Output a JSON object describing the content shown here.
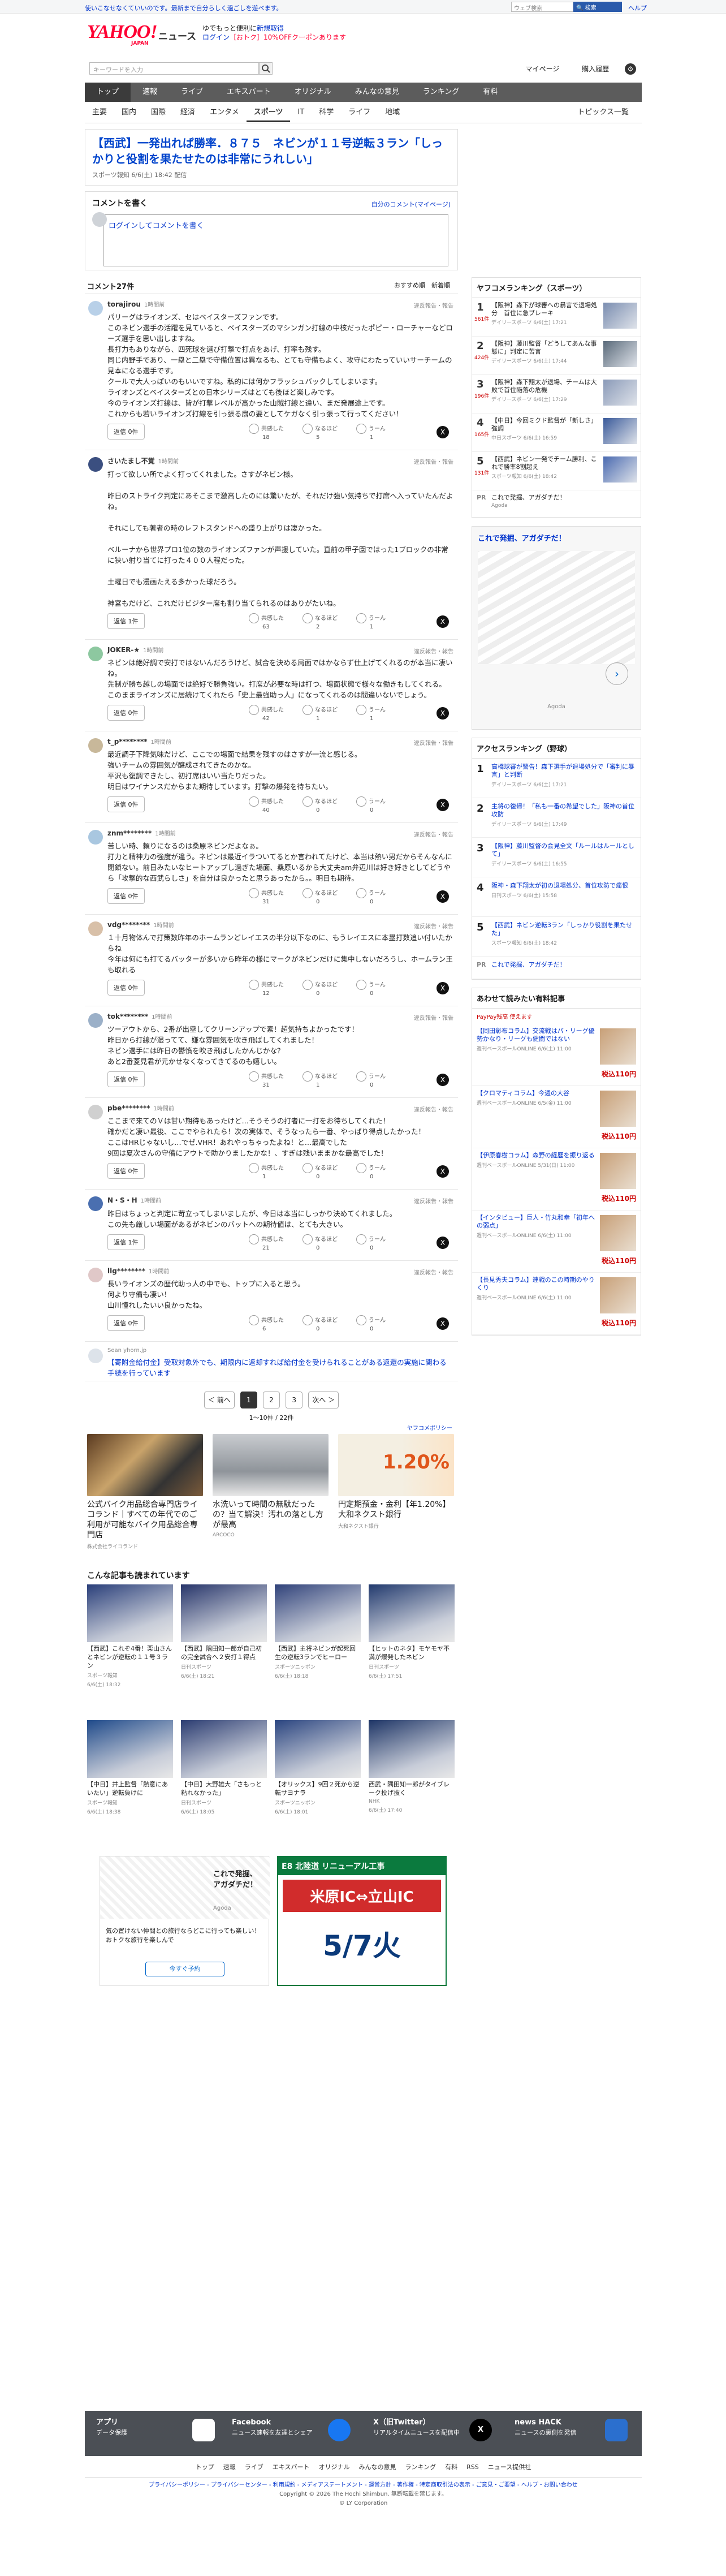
{
  "top": {
    "promo": "使いこなせなくていいのです。最新まで自分らしく過ごしを遊べます。",
    "links": "Yahoo! JAPAN　ヘルプ",
    "search_placeholder": "ウェブ検索",
    "search_button": "🔍 検索"
  },
  "header": {
    "logo_main": "YAHOO!",
    "logo_sub": "JAPAN",
    "service": "ニュース",
    "promo_line1": "ゆでもっと便利に",
    "promo_line1_link": "新規取得",
    "promo_line2_link": "ログイン",
    "promo_line2": "［おトク］10%OFFクーポンあります",
    "keyword_placeholder": "キーワードを入力",
    "mypage": "マイページ",
    "purchase": "購入履歴"
  },
  "nav1": [
    "トップ",
    "速報",
    "ライブ",
    "エキスパート",
    "オリジナル",
    "みんなの意見",
    "ランキング",
    "有料"
  ],
  "nav2": [
    "主要",
    "国内",
    "国際",
    "経済",
    "エンタメ",
    "スポーツ",
    "IT",
    "科学",
    "ライフ",
    "地域"
  ],
  "nav2_active": "スポーツ",
  "nav2_topics": "トピックス一覧",
  "article": {
    "title": "【西武】一発出れば勝率．８７５　ネビンが１１号逆転３ラン「しっかりと役割を果たせたのは非常にうれしい」",
    "meta": "スポーツ報知 6/6(土) 18:42 配信"
  },
  "comment_write": {
    "heading": "コメントを書く",
    "policy": "自分のコメント(マイページ)",
    "box": "ログインしてコメントを書く"
  },
  "comment_list": {
    "count": "コメント27件",
    "sort": "おすすめ順　新着順",
    "reply_label": "返信",
    "report_label": "違反報告・報告",
    "react_labels": [
      "共感した",
      "なるほど",
      "うーん"
    ],
    "items": [
      {
        "user": "torajirou",
        "time": "1時間前",
        "text": "パリーグはライオンズ、セはベイスターズファンです。\nこのネビン選手の活躍を見ていると、ベイスターズのマシンガン打線の中核だったポピー・ローチャーなどローズ選手を思い出しますね。\n長打力もありながら、四死球を選び打撃で打点をあげ、打率も残す。\n同じ内野手であり、一塁と二塁で守備位置は異なるも、とても守備もよく、攻守にわたっていいサーチームの見本になる選手です。\nクールで大人っぽいのもいいですね。私的には何かフラッシュバックしてしまいます。\nライオンズとベイスターズとの日本シリーズはとても後ほど楽しみです。\n今のライオンズ打線は、皆が打撃レベルが高かった山賊打線と違い、まだ発展途上です。\nこれからも若いライオンズ打線を引っ張る扇の要としてケガなく引っ張って行ってください！",
        "reply": "返信 0件",
        "r": [
          18,
          5,
          1
        ]
      },
      {
        "user": "さいたまし不覚",
        "time": "1時間前",
        "text": "打って欲しい所でよく打ってくれました。さすがネビン様。\n\n昨日のストライク判定にあそこまで激高したのには驚いたが、それだけ強い気持ちで打席へ入っていたんだよね。\n\nそれにしても著者の時のレフトスタンドへの盛り上がりは凄かった。\n\nベルーナから世界プロ1位の数のライオンズファンが声援していた。直前の甲子園ではった1ブロックの非常に狭い射り当てに打った４００人程だった。\n\n土曜日でも漫画たえる多かった球だろう。\n\n神宮もだけど、これだけビジター席も割り当てられるのはありがたいね。",
        "reply": "返信 1件",
        "r": [
          63,
          2,
          1
        ]
      },
      {
        "user": "JOKER-★",
        "time": "1時間前",
        "text": "ネビンは絶好調で安打ではないんだろうけど、試合を決める局面ではかならず仕上げてくれるのが本当に凄いね。\n先制が勝ち越しの場面では絶好で勝負強い。打席が必要な時は打つ、場面状態で様々な働きもしてくれる。\nこのままライオンズに居続けてくれたら「史上最強助っ人」になってくれるのは間違いないでしょう。",
        "reply": "返信 0件",
        "r": [
          42,
          1,
          1
        ]
      },
      {
        "user": "t_p********",
        "time": "1時間前",
        "text": "最近調子下降気味だけど、ここでの場面で結果を残すのはさすが一流と感じる。\n強いチームの雰囲気が醸成されてきたのかな。\n平沢も復調できたし、初打席はいい当たりだった。\n明日はワイナンスだからまた期待しています。打撃の爆発を待ちたい。",
        "reply": "返信 0件",
        "r": [
          40,
          0,
          0
        ]
      },
      {
        "user": "znm********",
        "time": "1時間前",
        "text": "苦しい時、頼りになるのは桑原ネビンだよなぁ。\n打力と精神力の強度が違う。ネビンは最近イラついてるとか言われてたけど、本当は熱い男だからそんなんに閉鎖ない。前日みたいなヒートアップし過ぎた場面、桑原いるから大丈夫am弁辺川は好き好きとしてどうやら「攻撃的な西武らしさ」を自分は良かったと思うあったから。。明日も期待。",
        "reply": "返信 0件",
        "r": [
          31,
          0,
          0
        ]
      },
      {
        "user": "vdg********",
        "time": "1時間前",
        "text": "１十月物体んで打策数昨年のホームランどレイエスの半分以下なのに、もうレイエスに本塁打数追い付いたからね\n今年は何にも打てるバッターが多いから昨年の様にマークがネビンだけに集中しないだろうし、ホームラン王も取れる",
        "reply": "返信 0件",
        "r": [
          12,
          0,
          0
        ]
      },
      {
        "user": "tok********",
        "time": "1時間前",
        "text": "ツーアウトから、2番が出塁してクリーンアップで素！超気持ちよかったです！\n昨日から打線が湿ってて、嫌な雰囲気を吹き飛ばしてくれました！\nネビン選手には昨日の鬱憤を吹き飛ばしたかんじかな？\nあと2番菱見君が元かせなくなってきてるのも嬉しい。",
        "reply": "返信 0件",
        "r": [
          31,
          1,
          0
        ]
      },
      {
        "user": "pbe********",
        "time": "1時間前",
        "text": "ここまで来てのＶは甘い期待もあったけど…そうそうの打者に一打をお待ちしてくれた！\n確かだと凄い最後、ここでやられたら！次の実体で、そうなったら一番、やっぱり得点したかった！\nここはHRじゃないし…でゼ.VHR！あれやっちゃったよね！と…最高でした\n9回は夏次さんの守備にアウトで助かりましたかな！、すぎは残いままかな最高でした！",
        "reply": "返信 0件",
        "r": [
          1,
          0,
          0
        ]
      },
      {
        "user": "N・S・H",
        "time": "1時間前",
        "text": "昨日はちょっと判定に苛立ってしまいましたが、今日は本当にしっかり決めてくれました。\nこの先も厳しい場面があるがネビンのバットへの期待値は、とても大きい。",
        "reply": "返信 1件",
        "r": [
          21,
          0,
          0
        ]
      },
      {
        "user": "llg********",
        "time": "1時間前",
        "text": "長いライオンズの歴代助っ人の中でも、トップに入ると思う。\n何より守備も凄い！\n山川憧れしたいい良かったね。",
        "reply": "返信 0件",
        "r": [
          6,
          0,
          0
        ]
      }
    ]
  },
  "promo_comment": {
    "source": "Sean yhorn.jp",
    "text": "【寄附金給付金】受取対象外でも、期限内に返却すれば給付金を受けられることがある返還の実施に関わる手続を行っています"
  },
  "pager": {
    "prev": "＜ 前へ",
    "pages": [
      "1",
      "2",
      "3"
    ],
    "next": "次へ ＞",
    "count": "1〜10件 / 22件"
  },
  "ads": {
    "label": "ヤフコメポリシー",
    "items": [
      {
        "title": "公式バイク用品総合専門店ライコランド｜すべての年代でのご利用が可能なバイク用品総合専門店",
        "sponsor": "株式会社ライコランド"
      },
      {
        "title": "水洗いって時間の無駄だったの？当て解決！汚れの落とし方が最高",
        "sponsor": "ARCOCO"
      },
      {
        "title": "円定期預金・金利【年1.20%】大和ネクスト銀行",
        "sponsor": "大和ネクスト銀行"
      }
    ],
    "badge": "1.20%"
  },
  "related": {
    "heading": "こんな記事も読まれています",
    "cards": [
      {
        "title": "【西武】これぞ4番！栗山さんとネビンが逆転の１１号３ラン",
        "src": "スポーツ報知",
        "date": "6/6(土) 18:32"
      },
      {
        "title": "【西武】隅田知一郎が自己初の完全試合へ２安打１得点",
        "src": "日刊スポーツ",
        "date": "6/6(土) 18:21"
      },
      {
        "title": "【西武】主将ネビンが起死回生の逆転3ランでヒーロー",
        "src": "スポーツニッポン",
        "date": "6/6(土) 18:18"
      },
      {
        "title": "【ヒットのネタ】モヤモヤ不満が爆発したネビン",
        "src": "日刊スポーツ",
        "date": "6/6(土) 17:51"
      },
      {
        "title": "【中日】井上監督「熱意にあいたい」逆転負けに",
        "src": "スポーツ報知",
        "date": "6/6(土) 18:38"
      },
      {
        "title": "【中日】大野雄大「さもっと粘れなかった」",
        "src": "日刊スポーツ",
        "date": "6/6(土) 18:05"
      },
      {
        "title": "【オリックス】9回２死から逆転サヨナラ",
        "src": "スポーツニッポン",
        "date": "6/6(土) 18:01"
      },
      {
        "title": "西武・隅田知一郎がタイブレーク投げ抜く",
        "src": "NHK",
        "date": "6/6(土) 17:40"
      }
    ]
  },
  "banners": {
    "left_title": "これで発掘、アガダチだ！",
    "left_src": "Agoda",
    "left_text": "気の置けない仲間との旅行ならどこに行っても楽しい！おトクな旅行を楽しんで",
    "left_btn": "今すぐ予約",
    "right_line1": "E8 北陸道 リニューアル工事",
    "right_line2": "米原IC⇔立山IC",
    "right_date": "5/7火"
  },
  "sidebar": {
    "ranking_heading": "ヤフコメランキング（スポーツ）",
    "ranking": [
      {
        "n": "1",
        "k": "561件",
        "t": "【阪神】森下が球審への暴言で退場処分　首位に急ブレーキ",
        "s": "デイリースポーツ 6/6(土) 17:21"
      },
      {
        "n": "2",
        "k": "424件",
        "t": "【阪神】藤川監督「どうしてあんな事態に」判定に苦言",
        "s": "デイリースポーツ 6/6(土) 17:44"
      },
      {
        "n": "3",
        "k": "196件",
        "t": "【阪神】森下翔太が退場、チームは大敗で首位陥落の危機",
        "s": "デイリースポーツ 6/6(土) 17:29"
      },
      {
        "n": "4",
        "k": "165件",
        "t": "【中日】今回ミクド監督が「新しさ」強調",
        "s": "中日スポーツ 6/6(土) 16:59"
      },
      {
        "n": "5",
        "k": "131件",
        "t": "【西武】ネビン一発でチーム勝利、これで勝率8割超え",
        "s": "スポーツ報知 6/6(土) 18:42"
      }
    ],
    "ranking_pr": "これで発掘、アガダチだ！",
    "ranking_pr_src": "Agoda",
    "ad_heading": "これで発掘、アガダチだ！",
    "ad_src": "Agoda",
    "access_heading": "アクセスランキング（野球）",
    "access": [
      {
        "n": "1",
        "t": "高橋球審が警告！森下選手が退場処分で「審判に暴言」と判断",
        "s": "デイリースポーツ 6/6(土) 17:21"
      },
      {
        "n": "2",
        "t": "主将の復帰！「私も一番の希望でした」阪神の首位攻防",
        "s": "デイリースポーツ 6/6(土) 17:49"
      },
      {
        "n": "3",
        "t": "【阪神】藤川監督の会見全文「ルールはルールとして」",
        "s": "デイリースポーツ 6/6(土) 16:55"
      },
      {
        "n": "4",
        "t": "阪神・森下翔太が初の退場処分、首位攻防で痛恨",
        "s": "日刊スポーツ 6/6(土) 15:58"
      },
      {
        "n": "5",
        "t": "【西武】ネビン逆転3ラン「しっかり役割を果たせた」",
        "s": "スポーツ報知 6/6(土) 18:42"
      }
    ],
    "access_pr": "これで発掘、アガダチだ！",
    "shop_heading": "あわせて読みたい有料記事",
    "shop_sub": "PayPay残高 使えます",
    "shop": [
      {
        "t": "【岡田彰布コラム】交流戦はパ・リーグ優勢かなり・リーグも健闘ではない",
        "s": "週刊ベースボールONLINE 6/6(土) 11:00",
        "p": "税込110円"
      },
      {
        "t": "【クロマティコラム】今週の大谷",
        "s": "週刊ベースボールONLINE 6/5(金) 11:00",
        "p": "税込110円"
      },
      {
        "t": "【伊原春樹コラム】森野の経歴を振り返る",
        "s": "週刊ベースボールONLINE 5/31(日) 11:00",
        "p": "税込110円"
      },
      {
        "t": "【インタビュー】巨人・竹丸和幸「初年への弱点」",
        "s": "週刊ベースボールONLINE 6/6(土) 11:00",
        "p": "税込110円"
      },
      {
        "t": "【長見秀夫コラム】連戦のこの時期のやりくり",
        "s": "週刊ベースボールONLINE 6/6(土) 11:00",
        "p": "税込110円"
      }
    ]
  },
  "footer": {
    "app": "アプリ",
    "app_sub": "データ保護",
    "facebook": "Facebook",
    "facebook_sub": "ニュース速報を友達とシェア",
    "x": "X（旧Twitter）",
    "x_sub": "リアルタイムニュースを配信中",
    "hack": "news HACK",
    "hack_sub": "ニュースの裏側を発信",
    "links": [
      "トップ",
      "速報",
      "ライブ",
      "エキスパート",
      "オリジナル",
      "みんなの意見",
      "ランキング",
      "有料",
      "RSS",
      "ニュース提供社"
    ],
    "policy": "プライバシーポリシー - プライバシーセンター - 利用規約 - メディアステートメント - 運営方針 - 著作権 - 特定商取引法の表示 - ご意見・ご要望 - ヘルプ・お問い合わせ",
    "copy1": "Copyright © 2026 The Hochi Shimbun. 無断転載を禁じます。",
    "copy2": "© LY Corporation"
  }
}
